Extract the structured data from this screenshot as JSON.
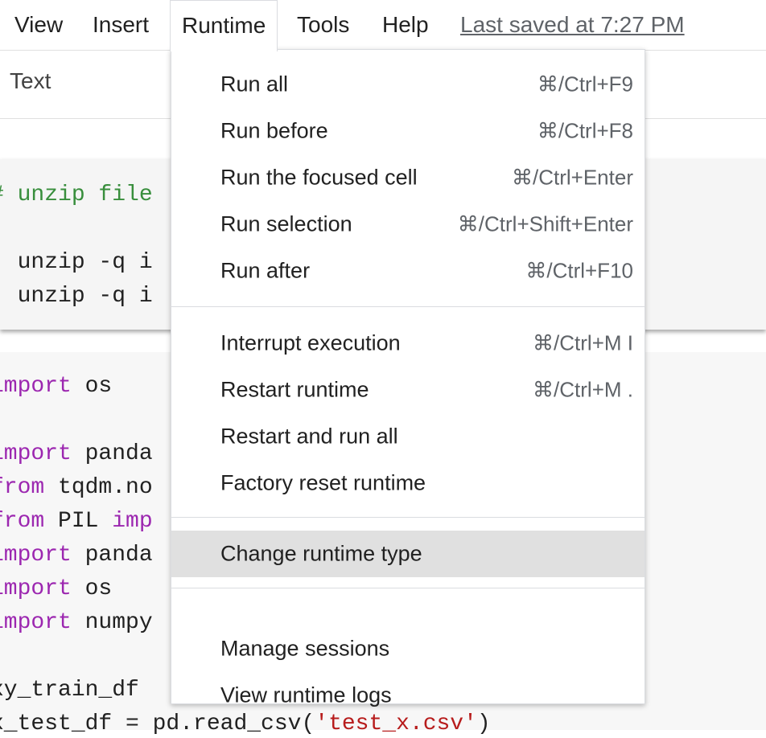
{
  "menubar": {
    "items": [
      "View",
      "Insert",
      "Runtime",
      "Tools",
      "Help"
    ],
    "last_saved": "Last saved at 7:27 PM"
  },
  "toolbar": {
    "text_button": "Text"
  },
  "cell1": {
    "lines": [
      {
        "parts": [
          [
            "cm",
            "# unzip file"
          ]
        ]
      },
      {
        "parts": [
          [
            "plain",
            ""
          ]
        ]
      },
      {
        "parts": [
          [
            "plain",
            "! unzip -q i"
          ]
        ]
      },
      {
        "parts": [
          [
            "plain",
            "! unzip -q i"
          ]
        ]
      }
    ]
  },
  "cell2": {
    "lines": [
      {
        "parts": [
          [
            "kw",
            "import"
          ],
          [
            "plain",
            " os"
          ]
        ]
      },
      {
        "parts": [
          [
            "plain",
            ""
          ]
        ]
      },
      {
        "parts": [
          [
            "kw",
            "import"
          ],
          [
            "plain",
            " panda"
          ]
        ]
      },
      {
        "parts": [
          [
            "kw",
            "from"
          ],
          [
            "plain",
            " tqdm.no"
          ]
        ]
      },
      {
        "parts": [
          [
            "kw",
            "from"
          ],
          [
            "plain",
            " PIL "
          ],
          [
            "kw",
            "imp"
          ]
        ]
      },
      {
        "parts": [
          [
            "kw",
            "import"
          ],
          [
            "plain",
            " panda"
          ]
        ]
      },
      {
        "parts": [
          [
            "kw",
            "import"
          ],
          [
            "plain",
            " os"
          ]
        ]
      },
      {
        "parts": [
          [
            "kw",
            "import"
          ],
          [
            "plain",
            " numpy"
          ]
        ]
      },
      {
        "parts": [
          [
            "plain",
            ""
          ]
        ]
      },
      {
        "parts": [
          [
            "plain",
            "xy_train_df"
          ]
        ]
      },
      {
        "parts": [
          [
            "plain",
            "x_test_df = pd.read_csv("
          ],
          [
            "str",
            "'test_x.csv'"
          ],
          [
            "plain",
            ")"
          ]
        ]
      }
    ]
  },
  "runtime_menu": {
    "groups": [
      [
        {
          "label": "Run all",
          "shortcut": "⌘/Ctrl+F9"
        },
        {
          "label": "Run before",
          "shortcut": "⌘/Ctrl+F8"
        },
        {
          "label": "Run the focused cell",
          "shortcut": "⌘/Ctrl+Enter"
        },
        {
          "label": "Run selection",
          "shortcut": "⌘/Ctrl+Shift+Enter"
        },
        {
          "label": "Run after",
          "shortcut": "⌘/Ctrl+F10"
        }
      ],
      [
        {
          "label": "Interrupt execution",
          "shortcut": "⌘/Ctrl+M I"
        },
        {
          "label": "Restart runtime",
          "shortcut": "⌘/Ctrl+M ."
        },
        {
          "label": "Restart and run all",
          "shortcut": ""
        },
        {
          "label": "Factory reset runtime",
          "shortcut": ""
        }
      ],
      [
        {
          "label": "Change runtime type",
          "shortcut": "",
          "highlighted": true
        }
      ],
      [
        {
          "label": "Manage sessions",
          "shortcut": ""
        },
        {
          "label": "View runtime logs",
          "shortcut": ""
        }
      ]
    ]
  }
}
